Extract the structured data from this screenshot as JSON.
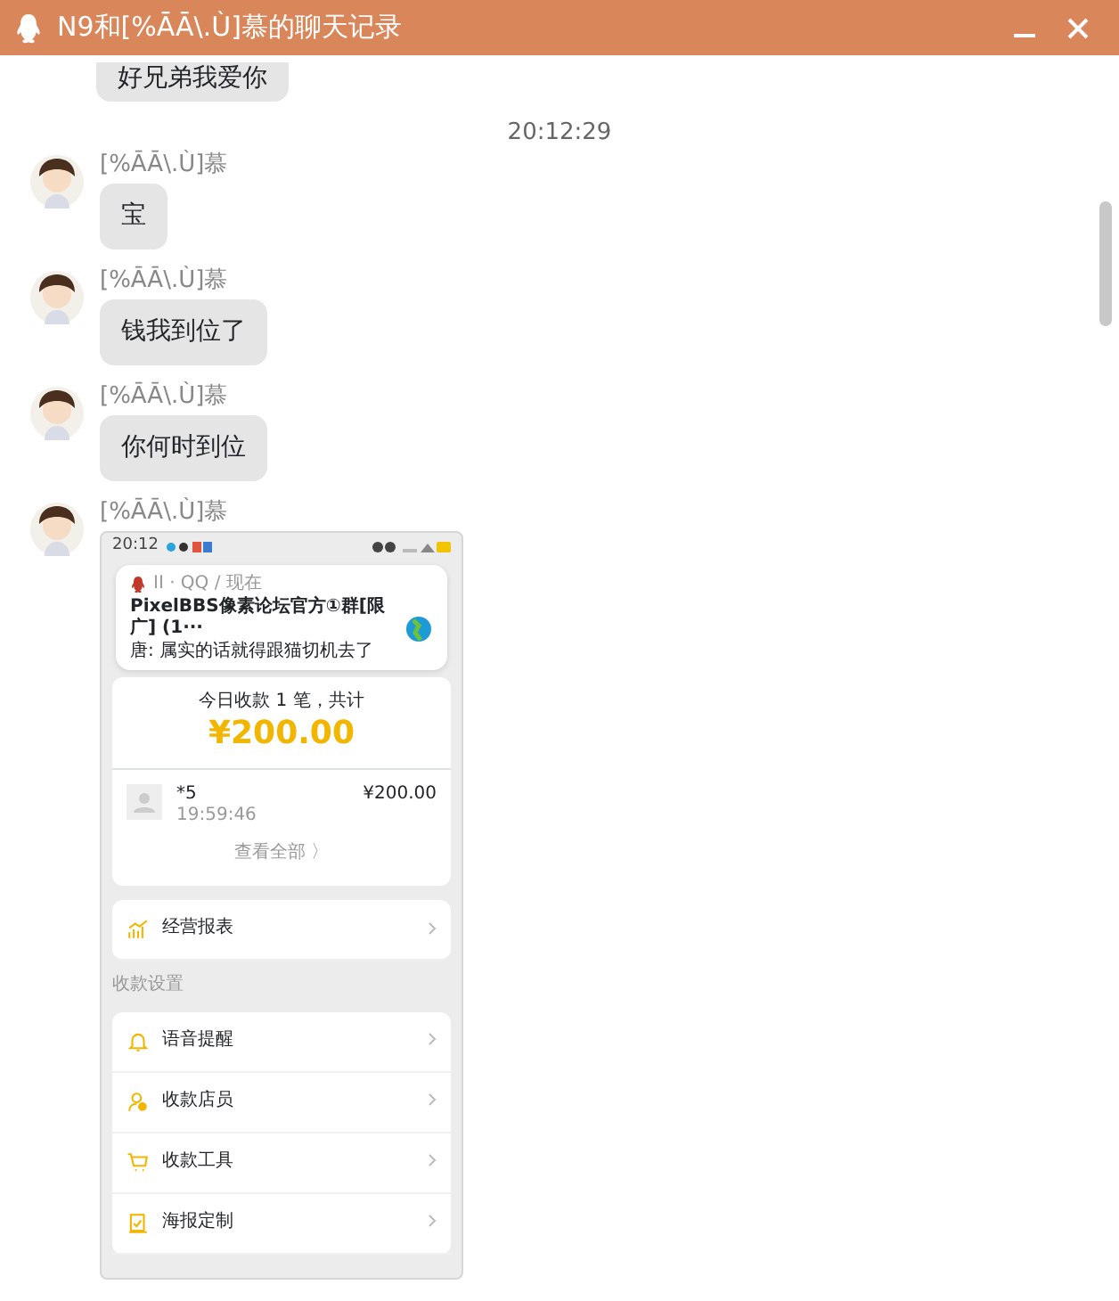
{
  "window": {
    "title": "N9和[%ĀĀ\\.Ù]慕的聊天记录"
  },
  "messages": [
    {
      "kind": "cut",
      "text": "好兄弟我爱你"
    },
    {
      "kind": "time",
      "text": "20:12:29"
    },
    {
      "kind": "text",
      "sender": "[%ĀĀ\\.Ù]慕",
      "text": "宝"
    },
    {
      "kind": "text",
      "sender": "[%ĀĀ\\.Ù]慕",
      "text": "钱我到位了"
    },
    {
      "kind": "text",
      "sender": "[%ĀĀ\\.Ù]慕",
      "text": "你何时到位"
    },
    {
      "kind": "image",
      "sender": "[%ĀĀ\\.Ù]慕",
      "phone": {
        "status_time": "20:12",
        "notification": {
          "app": "II · QQ / 现在",
          "title": "PixelBBS像素论坛官方①群[限广] (1···",
          "body": "唐: 属实的话就得跟猫切机去了"
        },
        "summary": {
          "caption": "今日收款 1 笔，共计",
          "amount": "¥200.00",
          "payment": {
            "name": "*5",
            "time": "19:59:46",
            "amount": "¥200.00"
          },
          "view_all": "查看全部 〉"
        },
        "report": "经营报表",
        "section": "收款设置",
        "settings": [
          {
            "kind": "bell",
            "label": "语音提醒"
          },
          {
            "kind": "person",
            "label": "收款店员"
          },
          {
            "kind": "cart",
            "label": "收款工具"
          },
          {
            "kind": "poster",
            "label": "海报定制"
          }
        ]
      }
    }
  ]
}
